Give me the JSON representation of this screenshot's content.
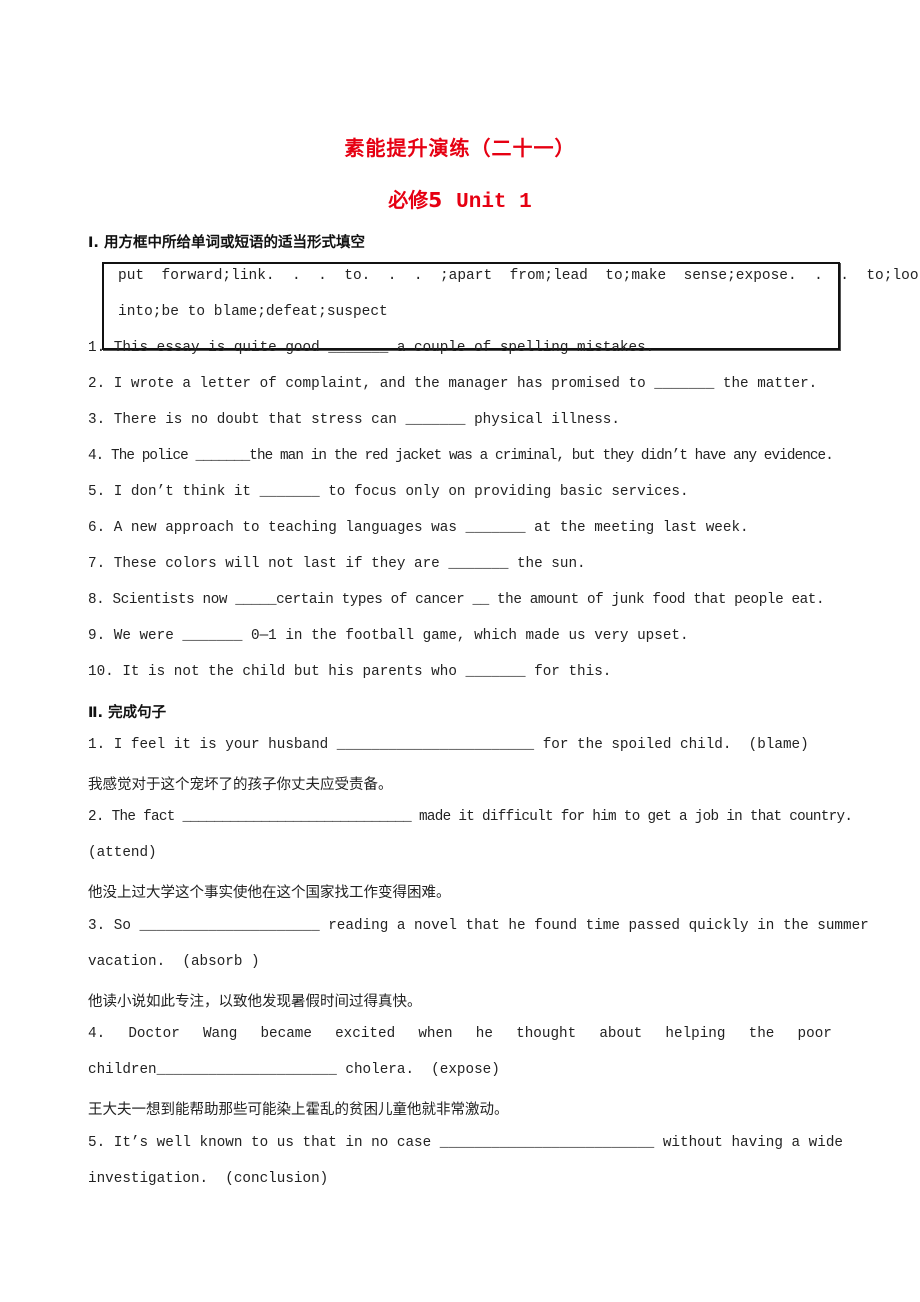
{
  "header": {
    "title": "素能提升演练（二十一）",
    "subtitle_cn": "必修5",
    "subtitle_en": "Unit 1",
    "accent_color": "#e60012"
  },
  "section1": {
    "heading": "Ⅰ. 用方框中所给单词或短语的适当形式填空",
    "word_box": {
      "line1": "put  forward;link.  .  .  to.  .  .  ;apart  from;lead  to;make  sense;expose.  .  .  to;look",
      "line2": "into;be to blame;defeat;suspect"
    },
    "items": [
      "1. This essay is quite good _______ a couple of spelling mistakes.",
      "2. I wrote a letter of complaint, and the manager has promised to _______ the matter.",
      "3. There is no doubt that stress can _______ physical illness.",
      "4. The police _______the man in the red jacket was a criminal, but they didn’t have any evidence.",
      "5. I don’t think it _______ to focus only on providing basic services.",
      "6. A new approach to teaching languages was _______ at the meeting last week.",
      "7. These colors will not last if they are _______ the sun.",
      "8. Scientists now _____certain types of cancer __ the amount of junk food that people eat.",
      "9. We were _______ 0—1 in the football game, which made us very upset.",
      "10. It is not the child but his parents who _______ for this."
    ]
  },
  "section2": {
    "heading": "Ⅱ. 完成句子",
    "items": [
      {
        "lines": [
          "1. I feel it is your husband _______________________ for the spoiled child.  (blame)"
        ],
        "translation": "我感觉对于这个宠坏了的孩子你丈夫应受责备。"
      },
      {
        "lines": [
          "2. The fact _____________________________ made it difficult for him to get a job in that country.",
          "(attend)"
        ],
        "translation": "他没上过大学这个事实使他在这个国家找工作变得困难。"
      },
      {
        "lines": [
          "3. So _____________________ reading a novel that he found time passed quickly in the summer",
          "vacation.  (absorb )"
        ],
        "translation": "他读小说如此专注，以致他发现暑假时间过得真快。"
      },
      {
        "words": [
          "4.",
          "Doctor",
          "Wang",
          "became",
          "excited",
          "when",
          "he",
          "thought",
          "about",
          "helping",
          "the",
          "poor"
        ],
        "lines": [
          "children_____________________ cholera.  (expose)"
        ],
        "translation": "王大夫一想到能帮助那些可能染上霍乱的贫困儿童他就非常激动。"
      },
      {
        "lines": [
          "5. It’s well known to us that in no case _________________________ without having a wide",
          "investigation.  (conclusion)"
        ]
      }
    ]
  }
}
